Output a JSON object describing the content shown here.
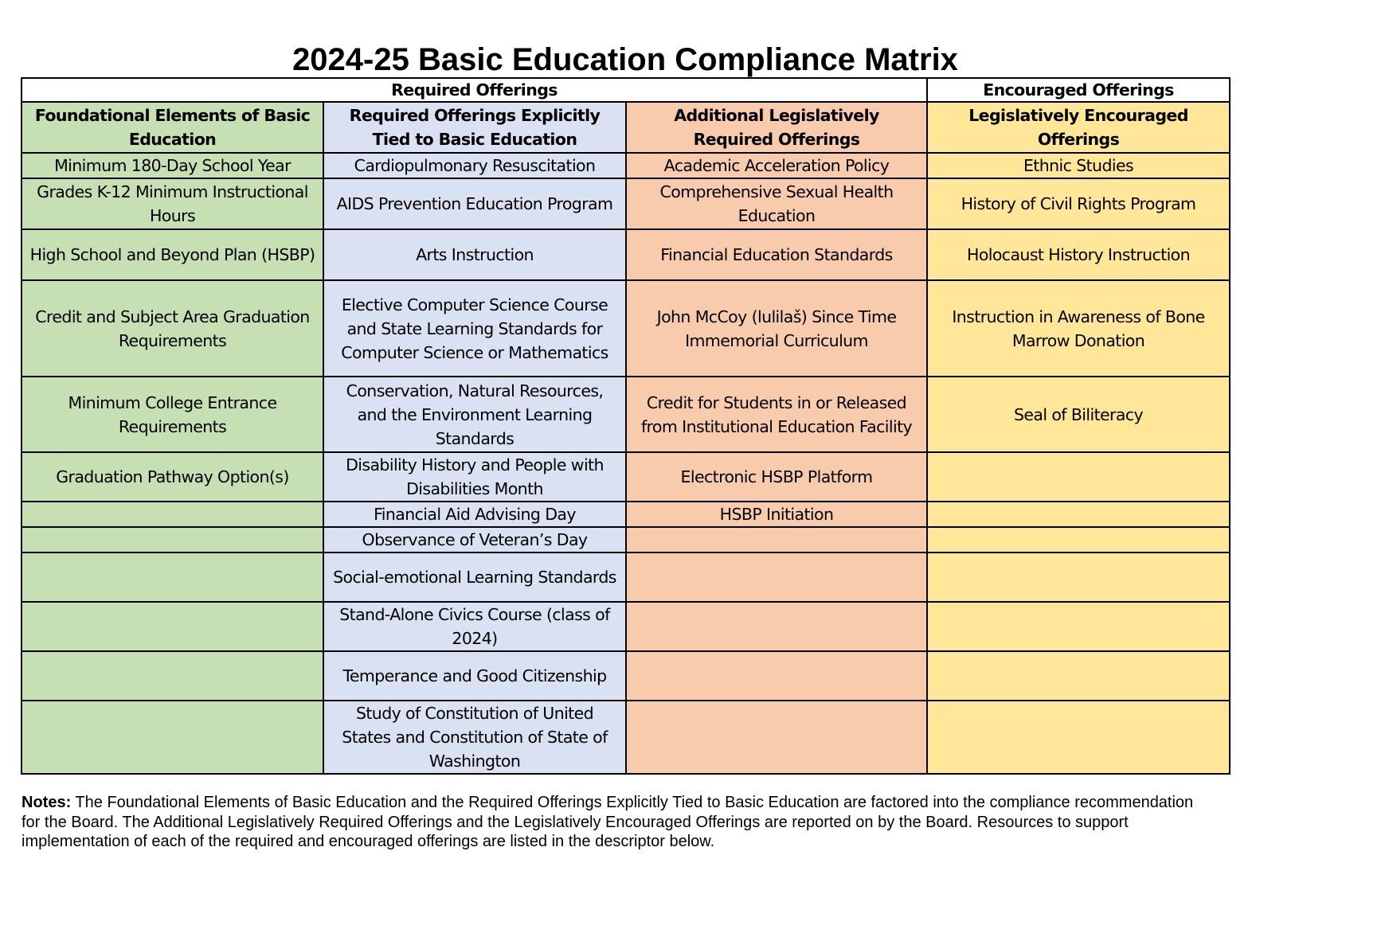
{
  "title": "2024-25 Basic Education Compliance Matrix",
  "colors": {
    "foundational": "#c6e0b4",
    "explicitly_tied": "#d9e1f2",
    "additional_required": "#f8cbad",
    "encouraged": "#ffe699",
    "border": "#000000"
  },
  "table": {
    "group_headers": [
      {
        "label": "Required Offerings",
        "span_columns": 3
      },
      {
        "label": "Encouraged Offerings",
        "span_columns": 1
      }
    ],
    "columns": [
      "Foundational Elements of Basic Education",
      "Required Offerings Explicitly Tied to Basic Education",
      "Additional Legislatively Required Offerings",
      "Legislatively Encouraged Offerings"
    ],
    "rows": [
      [
        "Minimum 180-Day School Year",
        "Cardiopulmonary Resuscitation",
        "Academic Acceleration Policy",
        "Ethnic Studies"
      ],
      [
        "Grades K-12 Minimum Instructional Hours",
        "AIDS Prevention Education Program",
        "Comprehensive Sexual Health Education",
        "History of Civil Rights Program"
      ],
      [
        "High School and Beyond Plan (HSBP)",
        "Arts Instruction",
        "Financial Education Standards",
        "Holocaust History Instruction"
      ],
      [
        "Credit and Subject Area Graduation Requirements",
        "Elective Computer Science Course and State Learning Standards for Computer Science or Mathematics",
        "John McCoy (lulilaš) Since Time Immemorial Curriculum",
        "Instruction in Awareness of Bone Marrow Donation"
      ],
      [
        "Minimum College Entrance Requirements",
        "Conservation, Natural Resources, and the Environment Learning Standards",
        "Credit for Students in or Released from Institutional Education Facility",
        "Seal of Biliteracy"
      ],
      [
        "Graduation Pathway Option(s)",
        "Disability History and People with Disabilities Month",
        "Electronic HSBP Platform",
        ""
      ],
      [
        "",
        "Financial Aid Advising Day",
        "HSBP Initiation",
        ""
      ],
      [
        "",
        "Observance of Veteran’s Day",
        "",
        ""
      ],
      [
        "",
        "Social-emotional Learning Standards",
        "",
        ""
      ],
      [
        "",
        "Stand-Alone Civics Course (class of 2024)",
        "",
        ""
      ],
      [
        "",
        "Temperance and Good Citizenship",
        "",
        ""
      ],
      [
        "",
        "Study of Constitution of United States and Constitution of State of Washington",
        "",
        ""
      ]
    ]
  },
  "notes": {
    "label": "Notes:",
    "text": " The Foundational Elements of Basic Education and the Required Offerings Explicitly Tied to Basic Education are factored into the compliance recommendation for the Board. The Additional Legislatively Required Offerings and the Legislatively Encouraged Offerings are reported on by the Board. Resources to support implementation of each of the required and encouraged offerings are listed in the descriptor below."
  }
}
